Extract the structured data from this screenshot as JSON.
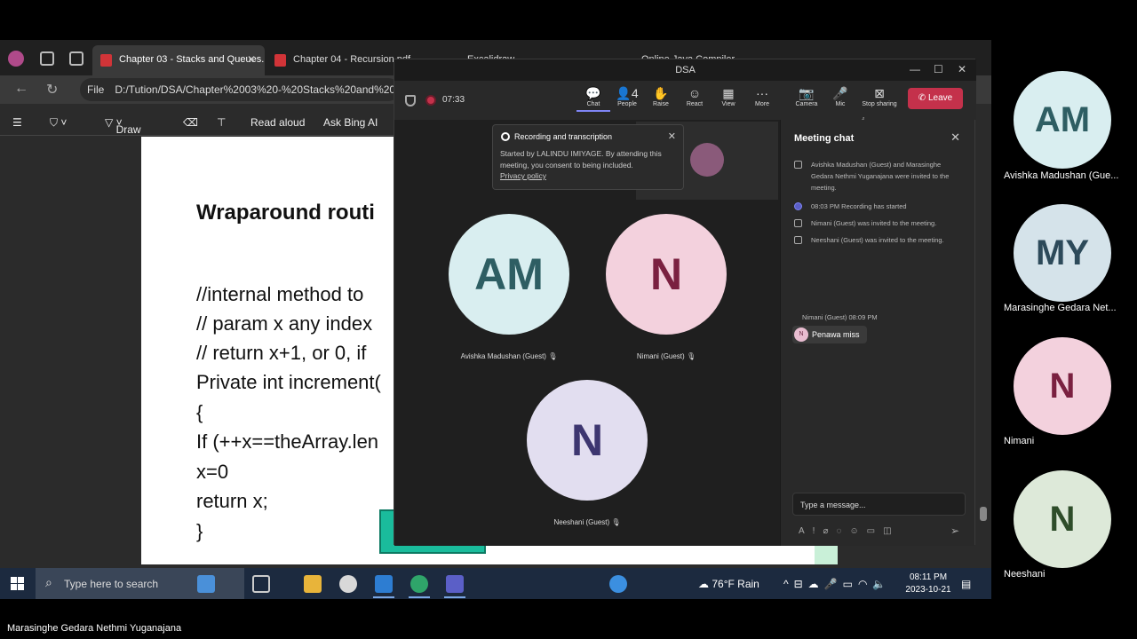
{
  "browser": {
    "tabs": [
      {
        "label": "Chapter 03 - Stacks and Queues.",
        "active": true
      },
      {
        "label": "Chapter 04 - Recursion.pdf",
        "active": false
      },
      {
        "label": "Excalidraw",
        "active": false
      },
      {
        "label": "Online Java Compiler",
        "active": false
      }
    ],
    "tab_close": "✕",
    "address_prefix": "File",
    "address": "D:/Tution/DSA/Chapter%2003%20-%20Stacks%20and%20Q",
    "toolbar": {
      "draw": "Draw",
      "read_aloud": "Read aloud",
      "ask_bing": "Ask Bing AI"
    }
  },
  "pdf": {
    "heading": "Wraparound routi",
    "code_lines": [
      "//internal method to",
      "// param x any index",
      "// return x+1, or 0, if",
      "Private int increment(",
      "{",
      "If (++x==theArray.len",
      "x=0",
      "return x;",
      "}"
    ]
  },
  "teams": {
    "window_title": "DSA",
    "timer": "07:33",
    "toolbar": [
      {
        "label": "Chat",
        "icon": "chat-icon",
        "glyph": "💬",
        "active": true
      },
      {
        "label": "People",
        "icon": "people-icon",
        "glyph": "👤4",
        "active": false
      },
      {
        "label": "Raise",
        "icon": "hand-icon",
        "glyph": "✋",
        "active": false
      },
      {
        "label": "React",
        "icon": "smiley-icon",
        "glyph": "☺",
        "active": false
      },
      {
        "label": "View",
        "icon": "view-icon",
        "glyph": "▦",
        "active": false
      },
      {
        "label": "More",
        "icon": "more-icon",
        "glyph": "···",
        "active": false
      },
      {
        "label": "Camera",
        "icon": "camera-off-icon",
        "glyph": "📷",
        "active": false
      },
      {
        "label": "Mic",
        "icon": "mic-icon",
        "glyph": "🎤",
        "active": false
      },
      {
        "label": "Stop sharing",
        "icon": "stop-share-icon",
        "glyph": "⊠",
        "active": false
      }
    ],
    "leave_label": "Leave",
    "toast": {
      "title": "Recording and transcription",
      "body": "Started by LALINDU IMIYAGE. By attending this meeting, you consent to being included.",
      "link": "Privacy policy"
    },
    "participants": [
      {
        "initials": "AM",
        "name": "Avishka Madushan (Guest)",
        "bg": "#d9eef0",
        "fg": "#2e5e63"
      },
      {
        "initials": "N",
        "name": "Nimani (Guest)",
        "bg": "#f3d1dd",
        "fg": "#7a2040"
      },
      {
        "initials": "N",
        "name": "Neeshani (Guest)",
        "bg": "#e2def0",
        "fg": "#3d3670"
      }
    ],
    "chat": {
      "title": "Meeting chat",
      "events": [
        {
          "type": "invite",
          "text": "Avishka Madushan (Guest) and Marasinghe Gedara Nethmi Yuganajana were invited to the meeting."
        },
        {
          "type": "record",
          "text": "08:03 PM   Recording has started"
        },
        {
          "type": "invite",
          "text": "Nimani (Guest) was invited to the meeting."
        },
        {
          "type": "invite",
          "text": "Neeshani (Guest) was invited to the meeting."
        }
      ],
      "message_meta": "Nimani (Guest)   08:09 PM",
      "message_avatar": "N",
      "message_text": "Penawa miss",
      "composer_placeholder": "Type a message..."
    }
  },
  "taskbar": {
    "search_placeholder": "Type here to search",
    "weather": "76°F  Rain",
    "time": "08:11 PM",
    "date": "2023-10-21"
  },
  "rail": [
    {
      "initials": "AM",
      "name": "Avishka Madushan (Gue...",
      "bg": "#d9eef0",
      "fg": "#2e5e63"
    },
    {
      "initials": "MY",
      "name": "Marasinghe Gedara Net...",
      "bg": "#d5e3ea",
      "fg": "#2d4a5a"
    },
    {
      "initials": "N",
      "name": "Nimani",
      "bg": "#f3d1dd",
      "fg": "#7a2040"
    },
    {
      "initials": "N",
      "name": "Neeshani",
      "bg": "#dde9d9",
      "fg": "#2e4d2a"
    }
  ],
  "presenter_name": "Marasinghe Gedara Nethmi Yuganajana"
}
